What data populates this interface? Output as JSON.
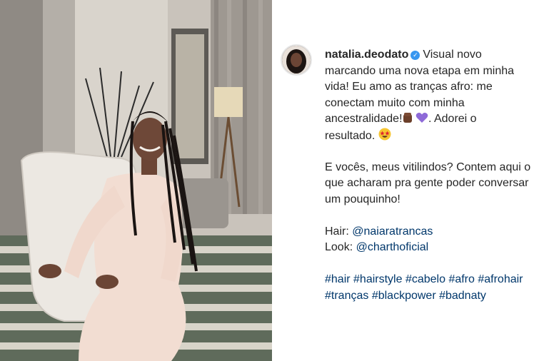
{
  "post": {
    "username": "natalia.deodato",
    "verified_icon": "verified-badge-icon",
    "caption_lines": [
      "Visual novo",
      "marcando uma nova etapa em minha",
      "vida! Eu amo as tranças afro: me",
      "conectam muito com minha",
      "ancestralidade!",
      ". Adorei o",
      "resultado."
    ],
    "question_lines": [
      "E vocês, meus vitilindos? Contem aqui o",
      "que acharam pra gente poder conversar",
      "um pouquinho!"
    ],
    "credits": {
      "hair_label": "Hair:",
      "hair_handle": "@naiaratrancas",
      "look_label": "Look:",
      "look_handle": "@charthoficial"
    },
    "hashtag_lines": [
      "#hair #hairstyle #cabelo #afro #afrohair",
      "#tranças #blackpower #badnaty"
    ],
    "emojis": {
      "raised_fist": "raised-fist-dark-skin-icon",
      "purple_heart": "purple-heart-icon",
      "star_struck": "star-struck-face-icon"
    }
  },
  "colors": {
    "text": "#262626",
    "link": "#00376b",
    "verified": "#3897f0"
  }
}
